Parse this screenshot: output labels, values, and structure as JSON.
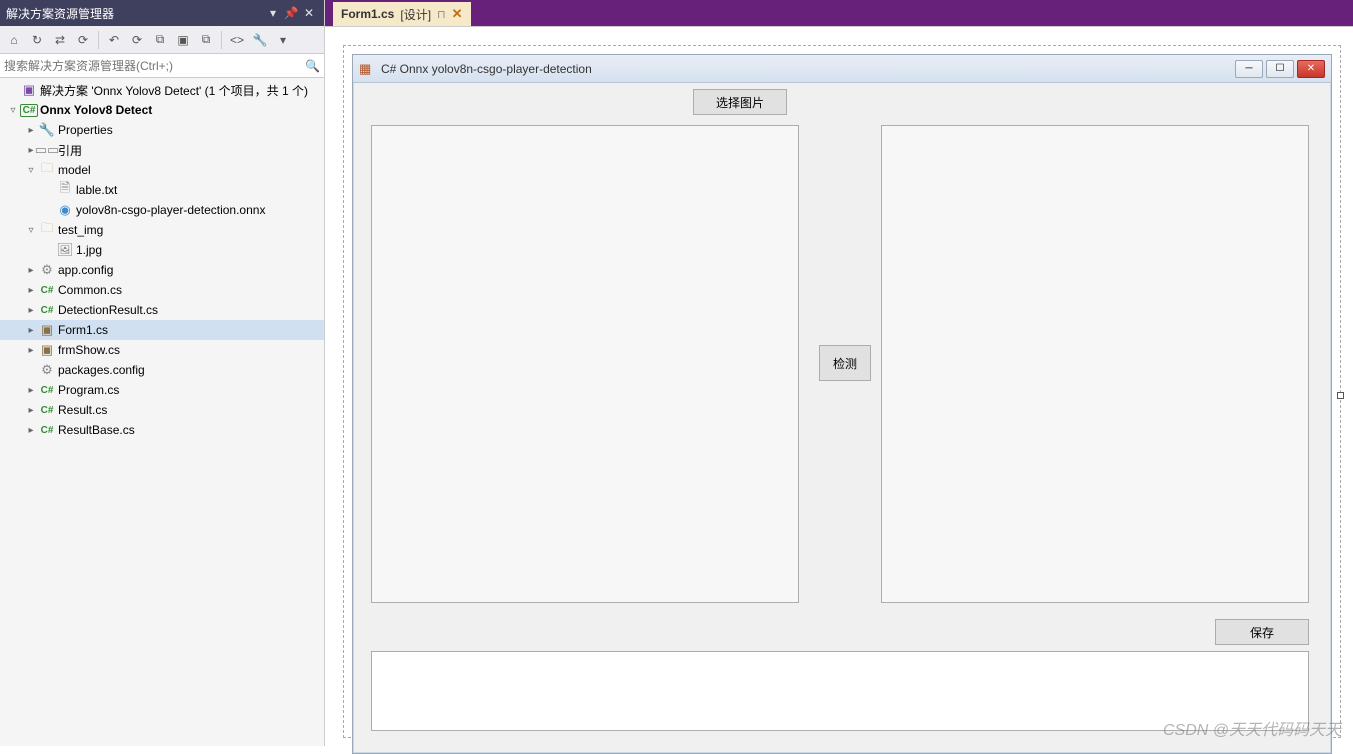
{
  "solution_explorer": {
    "title": "解决方案资源管理器",
    "title_buttons": {
      "dropdown": "▾",
      "pin": "📌",
      "close": "✕"
    },
    "toolbar_icons": [
      "⌂",
      "↻",
      "⇄",
      "⟳",
      "|",
      "↶",
      "⟳",
      "⧉",
      "▣",
      "⧉",
      "|",
      "<>",
      "🔧",
      "▾"
    ],
    "search_placeholder": "搜索解决方案资源管理器(Ctrl+;)",
    "search_icon": "🔍",
    "tree": [
      {
        "depth": 0,
        "twisty": "",
        "icon": "sln",
        "glyph": "▣",
        "label": "解决方案 'Onnx Yolov8 Detect' (1 个项目，共 1 个)",
        "selected": false
      },
      {
        "depth": 0,
        "twisty": "▿",
        "icon": "proj",
        "glyph": "C#",
        "label": "Onnx Yolov8 Detect",
        "bold": true
      },
      {
        "depth": 1,
        "twisty": "▸",
        "icon": "wrench",
        "glyph": "🔧",
        "label": "Properties"
      },
      {
        "depth": 1,
        "twisty": "▸",
        "icon": "file",
        "glyph": "▭▭",
        "label": "引用"
      },
      {
        "depth": 1,
        "twisty": "▿",
        "icon": "fold",
        "glyph": "🗀",
        "label": "model"
      },
      {
        "depth": 2,
        "twisty": "",
        "icon": "file",
        "glyph": "🗎",
        "label": "lable.txt"
      },
      {
        "depth": 2,
        "twisty": "",
        "icon": "globe",
        "glyph": "◉",
        "label": "yolov8n-csgo-player-detection.onnx"
      },
      {
        "depth": 1,
        "twisty": "▿",
        "icon": "fold",
        "glyph": "🗀",
        "label": "test_img"
      },
      {
        "depth": 2,
        "twisty": "",
        "icon": "file",
        "glyph": "🖼",
        "label": "1.jpg"
      },
      {
        "depth": 1,
        "twisty": "▸",
        "icon": "file",
        "glyph": "⚙",
        "label": "app.config"
      },
      {
        "depth": 1,
        "twisty": "▸",
        "icon": "cs",
        "glyph": "C#",
        "label": "Common.cs"
      },
      {
        "depth": 1,
        "twisty": "▸",
        "icon": "cs",
        "glyph": "C#",
        "label": "DetectionResult.cs"
      },
      {
        "depth": 1,
        "twisty": "▸",
        "icon": "form",
        "glyph": "▣",
        "label": "Form1.cs",
        "selected": true
      },
      {
        "depth": 1,
        "twisty": "▸",
        "icon": "form",
        "glyph": "▣",
        "label": "frmShow.cs"
      },
      {
        "depth": 1,
        "twisty": "",
        "icon": "file",
        "glyph": "⚙",
        "label": "packages.config"
      },
      {
        "depth": 1,
        "twisty": "▸",
        "icon": "cs",
        "glyph": "C#",
        "label": "Program.cs"
      },
      {
        "depth": 1,
        "twisty": "▸",
        "icon": "cs",
        "glyph": "C#",
        "label": "Result.cs"
      },
      {
        "depth": 1,
        "twisty": "▸",
        "icon": "cs",
        "glyph": "C#",
        "label": "ResultBase.cs"
      }
    ]
  },
  "document_tab": {
    "filename": "Form1.cs",
    "mode": "[设计]",
    "pin": "⊓",
    "close": "✕"
  },
  "winform": {
    "title": "C# Onnx yolov8n-csgo-player-detection",
    "buttons": {
      "select_image": "选择图片",
      "detect": "检测",
      "save": "保存"
    },
    "win_buttons": {
      "min": "─",
      "max": "☐",
      "close": "✕"
    }
  },
  "watermark": "CSDN @天天代码码天天"
}
